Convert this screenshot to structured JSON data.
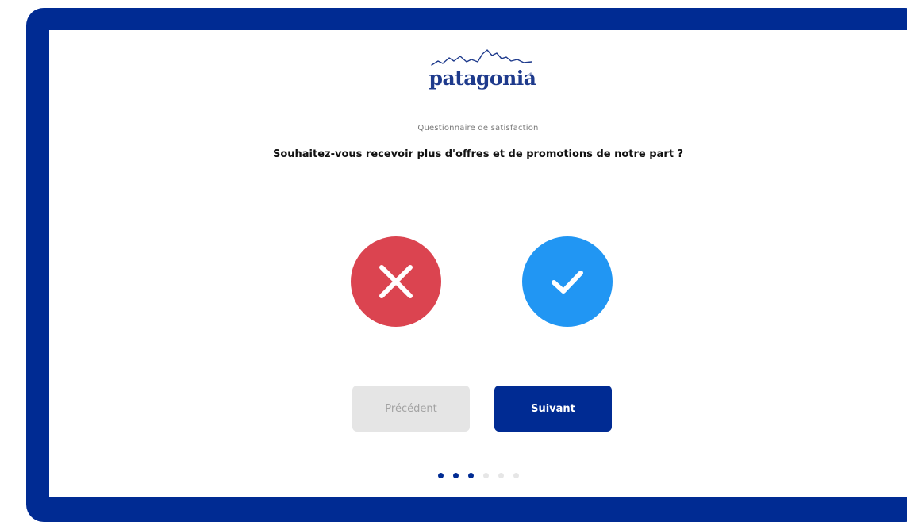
{
  "brand": {
    "name": "patagonia",
    "registered_mark": "®",
    "primary_color": "#002b93",
    "logo_color": "#1e3a8c"
  },
  "survey": {
    "subtitle": "Questionnaire de satisfaction",
    "question": "Souhaitez-vous recevoir plus d'offres et de promotions de notre part ?"
  },
  "choices": [
    {
      "id": "no",
      "icon": "close-icon",
      "color": "#db4450"
    },
    {
      "id": "yes",
      "icon": "check-icon",
      "color": "#2196f3"
    }
  ],
  "navigation": {
    "prev_label": "Précédent",
    "next_label": "Suivant",
    "prev_enabled": false,
    "next_enabled": true
  },
  "progress": {
    "total_steps": 6,
    "completed_steps": 3
  }
}
